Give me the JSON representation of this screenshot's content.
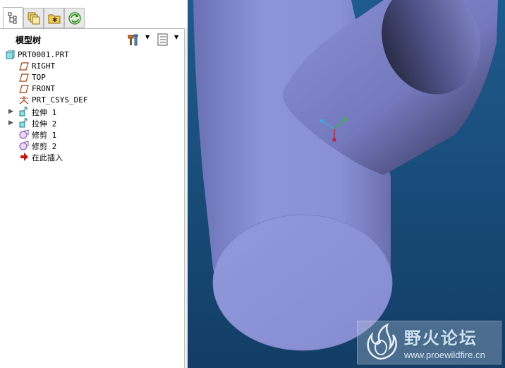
{
  "tree_title": "模型树",
  "tree_items": [
    {
      "label": "PRT0001.PRT",
      "icon": "part-icon",
      "expandable": false
    },
    {
      "label": "RIGHT",
      "icon": "datum-plane-icon",
      "expandable": false
    },
    {
      "label": "TOP",
      "icon": "datum-plane-icon",
      "expandable": false
    },
    {
      "label": "FRONT",
      "icon": "datum-plane-icon",
      "expandable": false
    },
    {
      "label": "PRT_CSYS_DEF",
      "icon": "csys-icon",
      "expandable": false
    },
    {
      "label": "拉伸 1",
      "icon": "extrude-icon",
      "expandable": true
    },
    {
      "label": "拉伸 2",
      "icon": "extrude-icon",
      "expandable": true
    },
    {
      "label": "修剪 1",
      "icon": "trim-icon",
      "expandable": false
    },
    {
      "label": "修剪 2",
      "icon": "trim-icon",
      "expandable": false
    },
    {
      "label": "在此插入",
      "icon": "insert-here-icon",
      "expandable": false
    }
  ],
  "watermark": {
    "name": "野火论坛",
    "url": "www.proewildfire.cn"
  },
  "colors": {
    "viewport_bg": "#1a4f7e",
    "model_surface": "#8e94d8",
    "model_shadow": "#2d3050"
  }
}
